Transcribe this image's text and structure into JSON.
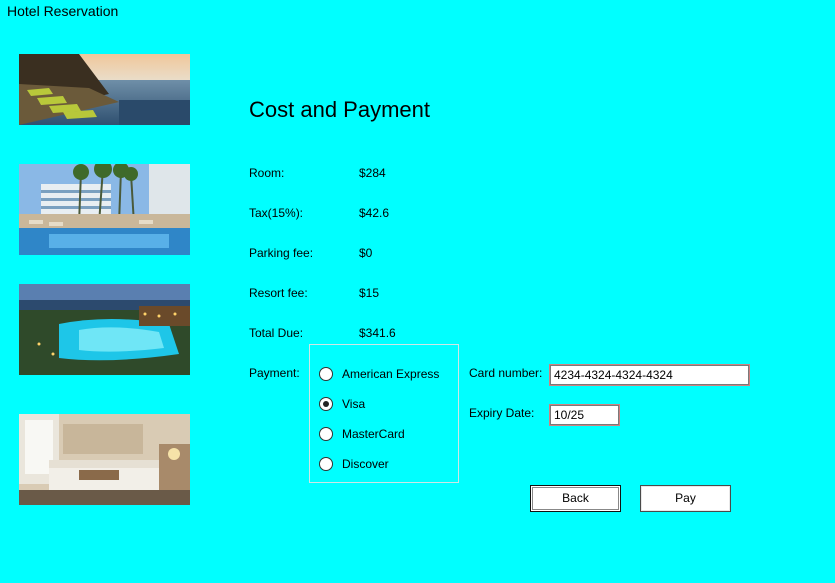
{
  "window": {
    "title": "Hotel Reservation"
  },
  "images": [
    {
      "name": "pool-lounge-photo"
    },
    {
      "name": "palm-hotel-pool-photo"
    },
    {
      "name": "resort-night-pool-photo"
    },
    {
      "name": "hotel-room-photo"
    }
  ],
  "heading": "Cost and Payment",
  "costs": [
    {
      "label": "Room:",
      "value": "$284"
    },
    {
      "label": "Tax(15%):",
      "value": "$42.6"
    },
    {
      "label": "Parking fee:",
      "value": "$0"
    },
    {
      "label": "Resort fee:",
      "value": "$15"
    },
    {
      "label": "Total Due:",
      "value": "$341.6"
    }
  ],
  "payment": {
    "label": "Payment:",
    "options": [
      {
        "label": "American Express",
        "selected": false
      },
      {
        "label": "Visa",
        "selected": true
      },
      {
        "label": "MasterCard",
        "selected": false
      },
      {
        "label": "Discover",
        "selected": false
      }
    ]
  },
  "card": {
    "number_label": "Card number:",
    "number_value": "4234-4324-4324-4324",
    "expiry_label": "Expiry Date:",
    "expiry_value": "10/25"
  },
  "buttons": {
    "back": "Back",
    "pay": "Pay"
  },
  "colors": {
    "background": "#00ffff"
  }
}
